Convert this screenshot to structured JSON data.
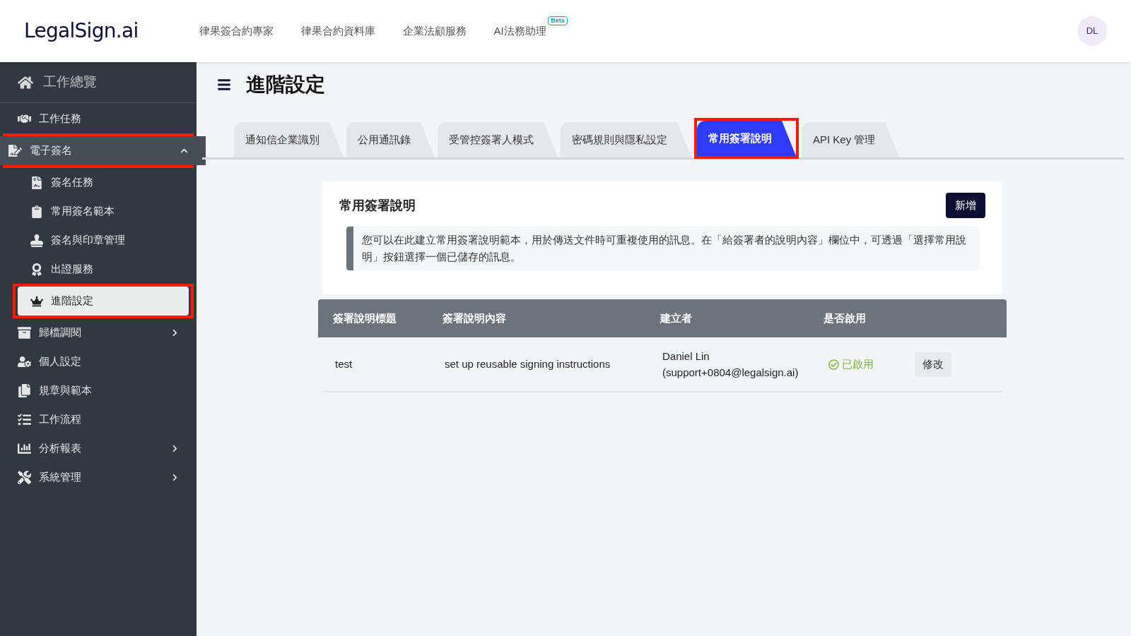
{
  "header": {
    "logo": "LegalSign.ai",
    "nav": [
      {
        "label": "律果簽合約專家"
      },
      {
        "label": "律果合約資料庫"
      },
      {
        "label": "企業法顧服務"
      },
      {
        "label": "AI法務助理",
        "badge": "Beta"
      }
    ],
    "avatar": "DL"
  },
  "sidebar": {
    "home": "工作總覽",
    "items": [
      {
        "label": "工作任務",
        "kind": "link",
        "highlighted": false
      },
      {
        "label": "電子簽名",
        "kind": "group",
        "expanded": true,
        "highlighted": true,
        "children": [
          {
            "label": "簽名任務",
            "selected": false,
            "highlighted": false
          },
          {
            "label": "常用簽名範本",
            "selected": false,
            "highlighted": false
          },
          {
            "label": "簽名與印章管理",
            "selected": false,
            "highlighted": false
          },
          {
            "label": "出證服務",
            "selected": false,
            "highlighted": false
          },
          {
            "label": "進階設定",
            "selected": true,
            "highlighted": true
          }
        ]
      },
      {
        "label": "歸檔調閱",
        "kind": "group",
        "expanded": false,
        "highlighted": false
      },
      {
        "label": "個人設定",
        "kind": "link",
        "highlighted": false
      },
      {
        "label": "規章與範本",
        "kind": "link",
        "highlighted": false
      },
      {
        "label": "工作流程",
        "kind": "link",
        "highlighted": false
      },
      {
        "label": "分析報表",
        "kind": "group",
        "expanded": false,
        "highlighted": false
      },
      {
        "label": "系統管理",
        "kind": "group",
        "expanded": false,
        "highlighted": false
      }
    ]
  },
  "page": {
    "title": "進階設定",
    "tabs": [
      {
        "label": "通知信企業識別",
        "selected": false,
        "highlighted": false
      },
      {
        "label": "公用通訊錄",
        "selected": false,
        "highlighted": false
      },
      {
        "label": "受管控簽署人模式",
        "selected": false,
        "highlighted": false
      },
      {
        "label": "密碼規則與隱私設定",
        "selected": false,
        "highlighted": false
      },
      {
        "label": "常用簽署說明",
        "selected": true,
        "highlighted": true
      },
      {
        "label": "API Key 管理",
        "selected": false,
        "highlighted": false
      }
    ],
    "card": {
      "title": "常用簽署說明",
      "add_button": "新增",
      "note": "您可以在此建立常用簽署說明範本，用於傳送文件時可重複使用的訊息。在「給簽署者的說明內容」欄位中，可透過「選擇常用說明」按鈕選擇一個已儲存的訊息。"
    },
    "table": {
      "columns": [
        "簽署說明標題",
        "簽署說明內容",
        "建立者",
        "是否啟用"
      ],
      "rows": [
        {
          "title": "test",
          "content": "set up reusable signing instructions",
          "creator": [
            "Daniel Lin",
            "(support+0804@legalsign.ai)"
          ],
          "enabled": true,
          "status": "已啟用",
          "action": "修改"
        }
      ]
    }
  }
}
